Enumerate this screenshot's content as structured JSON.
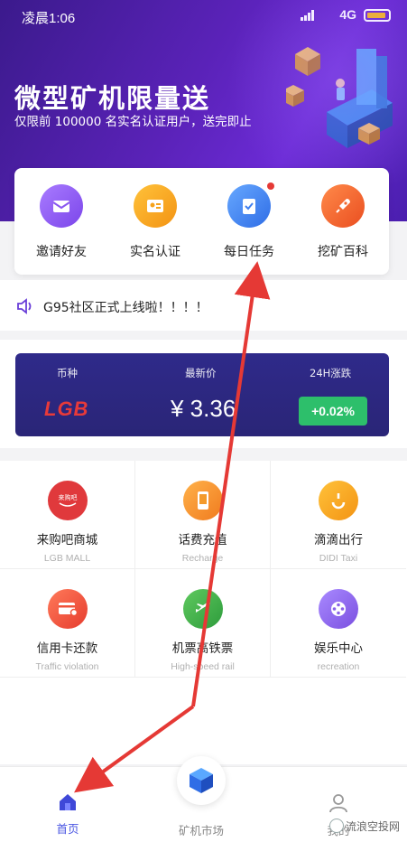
{
  "status_bar": {
    "time": "凌晨1:06",
    "network": "4G"
  },
  "promo": {
    "title": "微型矿机限量送",
    "subtitle": "仅限前 100000 名实名认证用户，送完即止"
  },
  "quick_actions": [
    {
      "label": "邀请好友",
      "icon": "mail-gift-icon",
      "color": "#8a57f0"
    },
    {
      "label": "实名认证",
      "icon": "id-card-icon",
      "color": "#f6a21a"
    },
    {
      "label": "每日任务",
      "icon": "checklist-icon",
      "color": "#3f7fef",
      "has_badge": true
    },
    {
      "label": "挖矿百科",
      "icon": "rocket-icon",
      "color": "#f2662e"
    }
  ],
  "notice": {
    "text": "G95社区正式上线啦！！！！"
  },
  "market": {
    "headers": [
      "币种",
      "最新价",
      "24H涨跌"
    ],
    "coin_logo": "LGB",
    "price": "¥ 3.36",
    "change": "+0.02%"
  },
  "services": [
    {
      "title": "来购吧商城",
      "subtitle": "LGB MALL",
      "icon": "laigouba-icon",
      "color": "#e0393c"
    },
    {
      "title": "话费充值",
      "subtitle": "Recharge",
      "icon": "phone-recharge-icon",
      "color": "#f49a2b"
    },
    {
      "title": "滴滴出行",
      "subtitle": "DIDI Taxi",
      "icon": "didi-icon",
      "color": "#f5a623"
    },
    {
      "title": "信用卡还款",
      "subtitle": "Traffic violation",
      "icon": "credit-card-icon",
      "color": "#f0533b"
    },
    {
      "title": "机票高铁票",
      "subtitle": "High-speed rail",
      "icon": "plane-icon",
      "color": "#44b24c"
    },
    {
      "title": "娱乐中心",
      "subtitle": "recreation",
      "icon": "film-reel-icon",
      "color": "#8a62e8"
    }
  ],
  "bottom_nav": [
    {
      "label": "首页",
      "icon": "home-icon",
      "active": true
    },
    {
      "label": "矿机市场",
      "icon": "miner-cube-icon",
      "active": false
    },
    {
      "label": "我的",
      "icon": "user-icon",
      "active": false
    }
  ],
  "watermark": "流浪空投网"
}
